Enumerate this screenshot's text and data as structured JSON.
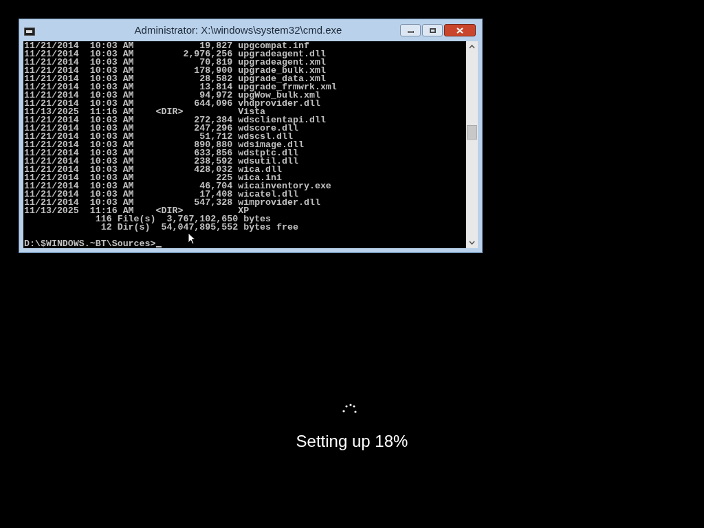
{
  "window": {
    "title": "Administrator: X:\\windows\\system32\\cmd.exe"
  },
  "console": {
    "lines": [
      "11/21/2014  10:03 AM            19,827 upgcompat.inf",
      "11/21/2014  10:03 AM         2,976,256 upgradeagent.dll",
      "11/21/2014  10:03 AM            70,819 upgradeagent.xml",
      "11/21/2014  10:03 AM           178,900 upgrade_bulk.xml",
      "11/21/2014  10:03 AM            28,582 upgrade_data.xml",
      "11/21/2014  10:03 AM            13,814 upgrade_frmwrk.xml",
      "11/21/2014  10:03 AM            94,972 upgWow_bulk.xml",
      "11/21/2014  10:03 AM           644,096 vhdprovider.dll",
      "11/13/2025  11:16 AM    <DIR>          Vista",
      "11/21/2014  10:03 AM           272,384 wdsclientapi.dll",
      "11/21/2014  10:03 AM           247,296 wdscore.dll",
      "11/21/2014  10:03 AM            51,712 wdscsl.dll",
      "11/21/2014  10:03 AM           890,880 wdsimage.dll",
      "11/21/2014  10:03 AM           633,856 wdstptc.dll",
      "11/21/2014  10:03 AM           238,592 wdsutil.dll",
      "11/21/2014  10:03 AM           428,032 wica.dll",
      "11/21/2014  10:03 AM               225 wica.ini",
      "11/21/2014  10:03 AM            46,704 wicainventory.exe",
      "11/21/2014  10:03 AM            17,408 wicatel.dll",
      "11/21/2014  10:03 AM           547,328 wimprovider.dll",
      "11/13/2025  11:16 AM    <DIR>          XP",
      "             116 File(s)  3,767,102,650 bytes",
      "              12 Dir(s)  54,047,895,552 bytes free"
    ],
    "prompt": "D:\\$WINDOWS.~BT\\Sources>"
  },
  "setup": {
    "status": "Setting up 18%"
  }
}
